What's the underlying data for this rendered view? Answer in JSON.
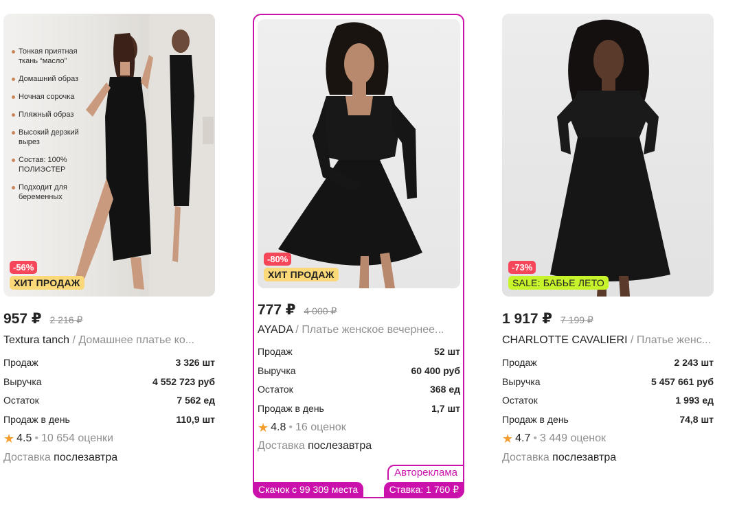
{
  "products": [
    {
      "discount": "-56%",
      "badge": "ХИТ ПРОДАЖ",
      "price": "957 ₽",
      "old_price": "2 216 ₽",
      "brand": "Textura tanch",
      "name": " / Домашнее платье ко...",
      "features": [
        "Тонкая приятная ткань “масло”",
        "Домашний образ",
        "Ночная сорочка",
        "Пляжный образ",
        "Высокий дерзкий вырез",
        "Состав: 100% ПОЛИЭСТЕР",
        "Подходит для беременных"
      ],
      "stats": [
        {
          "label": "Продаж",
          "value": "3 326 шт"
        },
        {
          "label": "Выручка",
          "value": "4 552 723 руб"
        },
        {
          "label": "Остаток",
          "value": "7 562 ед"
        },
        {
          "label": "Продаж в день",
          "value": "110,9 шт"
        }
      ],
      "rating": "4.5",
      "reviews": "10 654 оценки",
      "delivery_label": "Доставка",
      "delivery_value": "послезавтра"
    },
    {
      "discount": "-80%",
      "badge": "ХИТ ПРОДАЖ",
      "price": "777 ₽",
      "old_price": "4 000 ₽",
      "brand": "AYADA",
      "name": " / Платье женское вечернее...",
      "stats": [
        {
          "label": "Продаж",
          "value": "52 шт"
        },
        {
          "label": "Выручка",
          "value": "60 400 руб"
        },
        {
          "label": "Остаток",
          "value": "368 ед"
        },
        {
          "label": "Продаж в день",
          "value": "1,7 шт"
        }
      ],
      "rating": "4.8",
      "reviews": "16 оценок",
      "delivery_label": "Доставка",
      "delivery_value": "послезавтра",
      "ad_tag": "Автореклама",
      "ad_left": "Скачок с 99 309 места",
      "ad_right": "Ставка: 1 760 ₽"
    },
    {
      "discount": "-73%",
      "badge": "SALE: БАБЬЕ ЛЕТО",
      "price": "1 917 ₽",
      "old_price": "7 199 ₽",
      "brand": "CHARLOTTE CAVALIERI",
      "name": " / Платье женс...",
      "stats": [
        {
          "label": "Продаж",
          "value": "2 243 шт"
        },
        {
          "label": "Выручка",
          "value": "5 457 661 руб"
        },
        {
          "label": "Остаток",
          "value": "1 993 ед"
        },
        {
          "label": "Продаж в день",
          "value": "74,8 шт"
        }
      ],
      "rating": "4.7",
      "reviews": "3 449 оценок",
      "delivery_label": "Доставка",
      "delivery_value": "послезавтра"
    }
  ],
  "ui": {
    "rating_separator": "•",
    "star_icon": "★"
  }
}
